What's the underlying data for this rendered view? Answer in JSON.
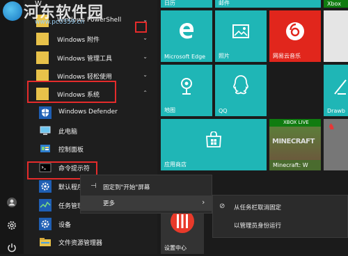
{
  "watermark": {
    "title": "河东软件园",
    "url": "www.pc0359.cn"
  },
  "list": {
    "letter": "W",
    "items": [
      {
        "label": "Windows PowerShell",
        "chev": "⌄"
      },
      {
        "label": "Windows 附件",
        "chev": "⌄"
      },
      {
        "label": "Windows 管理工具",
        "chev": "⌄"
      },
      {
        "label": "Windows 轻松使用",
        "chev": "⌄"
      },
      {
        "label": "Windows 系统",
        "chev": "⌃"
      }
    ],
    "subitems": [
      {
        "label": "Windows Defender"
      },
      {
        "label": "此电脑"
      },
      {
        "label": "控制面板"
      },
      {
        "label": "命令提示符"
      },
      {
        "label": "默认程序"
      },
      {
        "label": "任务管理器"
      },
      {
        "label": "设备"
      },
      {
        "label": "文件资源管理器"
      }
    ]
  },
  "tiles": {
    "calendar": "日历",
    "mail": "邮件",
    "xbox": "Xbox",
    "edge": "Microsoft Edge",
    "photos": "照片",
    "netease": "网易云音乐",
    "map": "地图",
    "qq": "QQ",
    "drawboard": "Drawb",
    "store": "应用商店",
    "xboxlive": "XBOX LIVE",
    "minecraft_logo": "MINECRAFT",
    "minecraft": "Minecraft: W",
    "settings_center": "设置中心"
  },
  "context_menu": {
    "pin": "固定到\"开始\"屏幕",
    "more": "更多",
    "more_arrow": "›"
  },
  "sub_menu": {
    "unpin_taskbar": "从任务栏取消固定",
    "run_admin": "以管理员身份运行"
  }
}
